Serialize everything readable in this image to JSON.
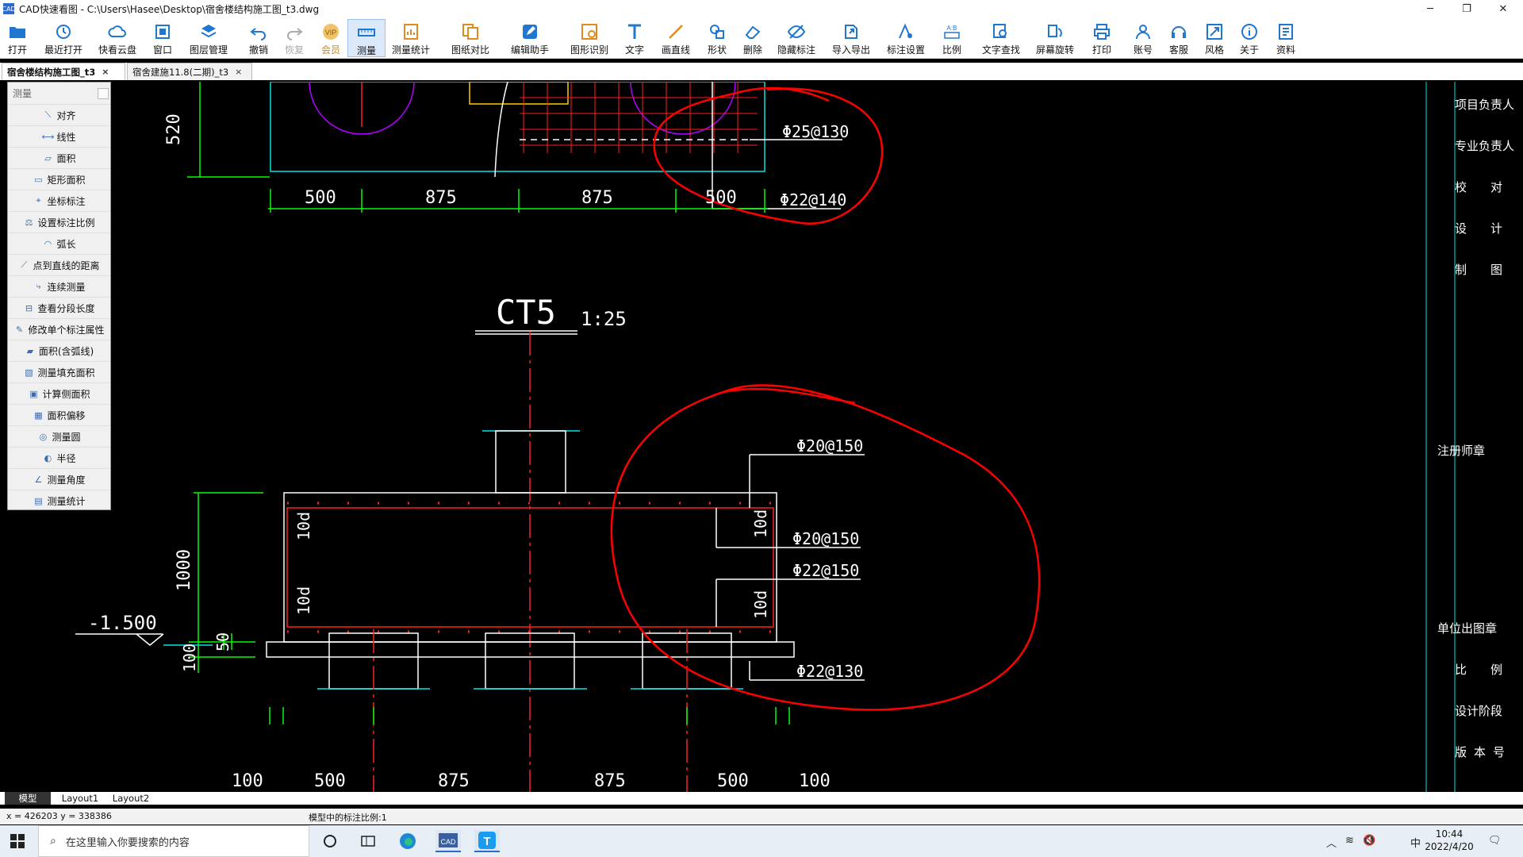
{
  "window": {
    "title": "CAD快速看图 - C:\\Users\\Hasee\\Desktop\\宿舍楼结构施工图_t3.dwg",
    "app_icon": "CAD",
    "minimize": "─",
    "restore": "❐",
    "close": "✕"
  },
  "toolbar": [
    {
      "name": "open",
      "label": "打开",
      "icon": "folder-icon"
    },
    {
      "name": "recent",
      "label": "最近打开",
      "icon": "history-icon"
    },
    {
      "name": "cloud",
      "label": "快看云盘",
      "icon": "cloud-icon"
    },
    {
      "name": "window",
      "label": "窗口",
      "icon": "window-icon"
    },
    {
      "name": "layers",
      "label": "图层管理",
      "icon": "layers-icon"
    },
    {
      "name": "undo",
      "label": "撤销",
      "icon": "undo-icon"
    },
    {
      "name": "redo",
      "label": "恢复",
      "icon": "redo-icon"
    },
    {
      "name": "vip",
      "label": "会员",
      "icon": "vip-icon"
    },
    {
      "name": "measure",
      "label": "测量",
      "icon": "ruler-icon"
    },
    {
      "name": "measure-stats",
      "label": "测量统计",
      "icon": "stats-icon"
    },
    {
      "name": "compare",
      "label": "图纸对比",
      "icon": "compare-icon"
    },
    {
      "name": "edit-assist",
      "label": "编辑助手",
      "icon": "edit-icon"
    },
    {
      "name": "shape-recog",
      "label": "图形识别",
      "icon": "recognize-icon"
    },
    {
      "name": "text",
      "label": "文字",
      "icon": "text-icon"
    },
    {
      "name": "line",
      "label": "画直线",
      "icon": "line-icon"
    },
    {
      "name": "shape",
      "label": "形状",
      "icon": "shape-icon"
    },
    {
      "name": "delete",
      "label": "删除",
      "icon": "eraser-icon"
    },
    {
      "name": "hide-annot",
      "label": "隐藏标注",
      "icon": "eye-icon"
    },
    {
      "name": "import-export",
      "label": "导入导出",
      "icon": "export-icon"
    },
    {
      "name": "annot-settings",
      "label": "标注设置",
      "icon": "settings-icon"
    },
    {
      "name": "scale",
      "label": "比例",
      "icon": "scale-icon"
    },
    {
      "name": "text-search",
      "label": "文字查找",
      "icon": "search-icon"
    },
    {
      "name": "rotate",
      "label": "屏幕旋转",
      "icon": "rotate-icon"
    },
    {
      "name": "print",
      "label": "打印",
      "icon": "printer-icon"
    },
    {
      "name": "account",
      "label": "账号",
      "icon": "user-icon"
    },
    {
      "name": "support",
      "label": "客服",
      "icon": "headset-icon"
    },
    {
      "name": "style",
      "label": "风格",
      "icon": "style-icon"
    },
    {
      "name": "about",
      "label": "关于",
      "icon": "info-icon"
    },
    {
      "name": "docs",
      "label": "资料",
      "icon": "docs-icon"
    }
  ],
  "doc_tabs": [
    {
      "label": "宿舍楼结构施工图_t3",
      "active": true,
      "close": "×"
    },
    {
      "label": "宿舍建施11.8(二期)_t3",
      "active": false,
      "close": "×"
    }
  ],
  "measure_panel": {
    "placeholder": "测量",
    "items": [
      "对齐",
      "线性",
      "面积",
      "矩形面积",
      "坐标标注",
      "设置标注比例",
      "弧长",
      "点到直线的距离",
      "连续测量",
      "查看分段长度",
      "修改单个标注属性",
      "面积(含弧线)",
      "测量填充面积",
      "计算侧面积",
      "面积偏移",
      "测量圆",
      "半径",
      "测量角度",
      "测量统计"
    ]
  },
  "drawing": {
    "top_dims": [
      "500",
      "875",
      "875",
      "500"
    ],
    "top_height": "520",
    "top_rebar": [
      "Φ25@130",
      "Φ22@140"
    ],
    "title": "CT5",
    "scale": "1:25",
    "rebar": [
      "Φ20@150",
      "Φ20@150",
      "Φ22@150",
      "Φ22@130"
    ],
    "anchor": "10d",
    "height": "1000",
    "cover": "50",
    "pad": "100",
    "elevation": "-1.500",
    "bottom_dims": [
      "100",
      "500",
      "875",
      "875",
      "500",
      "100"
    ]
  },
  "title_block": [
    "项目负责人",
    "专业负责人",
    "校　　对",
    "设　　计",
    "制　　图",
    "注册师章",
    "单位出图章",
    "比　　例",
    "设计阶段",
    "版 本 号"
  ],
  "layout_tabs": [
    "模型",
    "Layout1",
    "Layout2"
  ],
  "status": {
    "coords": "x = 426203  y = 338386",
    "scale_text": "模型中的标注比例:1"
  },
  "taskbar": {
    "search_placeholder": "在这里输入你要搜索的内容",
    "time": "10:44",
    "date": "2022/4/20",
    "ime": "中"
  },
  "colors": {
    "accent": "#2a6bd1",
    "cad_green": "#00ff00",
    "cad_red": "#ff2020",
    "cad_cyan": "#00e5e5",
    "cad_white": "#ffffff",
    "cad_magenta": "#b000ff",
    "annotation_red": "#ff0000"
  }
}
